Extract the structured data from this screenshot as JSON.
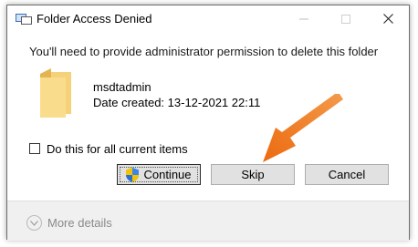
{
  "window": {
    "title": "Folder Access Denied",
    "controls": {
      "minimize": "minimize-icon",
      "maximize": "maximize-icon",
      "close": "close-icon"
    }
  },
  "dialog": {
    "message": "You'll need to provide administrator permission to delete this folder",
    "item": {
      "icon": "folder-icon",
      "name": "msdtadmin",
      "date_created": "Date created: 13-12-2021 22:11"
    },
    "checkbox": {
      "label": "Do this for all current items",
      "checked": false
    },
    "buttons": {
      "continue": "Continue",
      "skip": "Skip",
      "cancel": "Cancel"
    },
    "more_details": "More details"
  },
  "annotation": {
    "type": "arrow",
    "color": "#f07a22",
    "points_to": "skip-button"
  },
  "colors": {
    "folder": "#f5d27a",
    "folder_dark": "#e3b44f",
    "arrow": "#f07a22",
    "footer_bg": "#f0f0f0"
  }
}
